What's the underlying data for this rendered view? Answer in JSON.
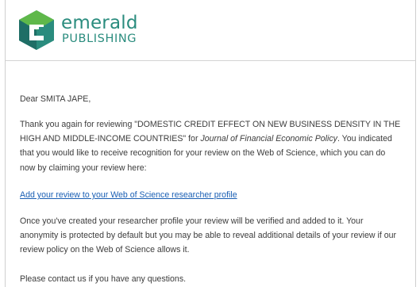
{
  "brand": {
    "name_top": "emerald",
    "name_bottom": "PUBLISHING",
    "color_primary": "#2a8c7e",
    "color_secondary": "#5fb84a"
  },
  "email": {
    "greeting": "Dear SMITA JAPE,",
    "para1_start": "Thank you again for reviewing \"DOMESTIC CREDIT EFFECT ON NEW BUSINESS DENSITY IN THE HIGH AND MIDDLE-INCOME COUNTRIES\" for ",
    "para1_journal": "Journal of Financial Economic Policy",
    "para1_end": ". You indicated that you would like to receive recognition for your review on the Web of Science, which you can do now by claiming your review here:",
    "link_text": "Add your review to your Web of Science researcher profile",
    "para2": "Once you've created your researcher profile your review will be verified and added to it. Your anonymity is protected by default but you may be able to reveal additional details of your review if our review policy on the Web of Science allows it.",
    "para3": "Please contact us if you have any questions."
  }
}
